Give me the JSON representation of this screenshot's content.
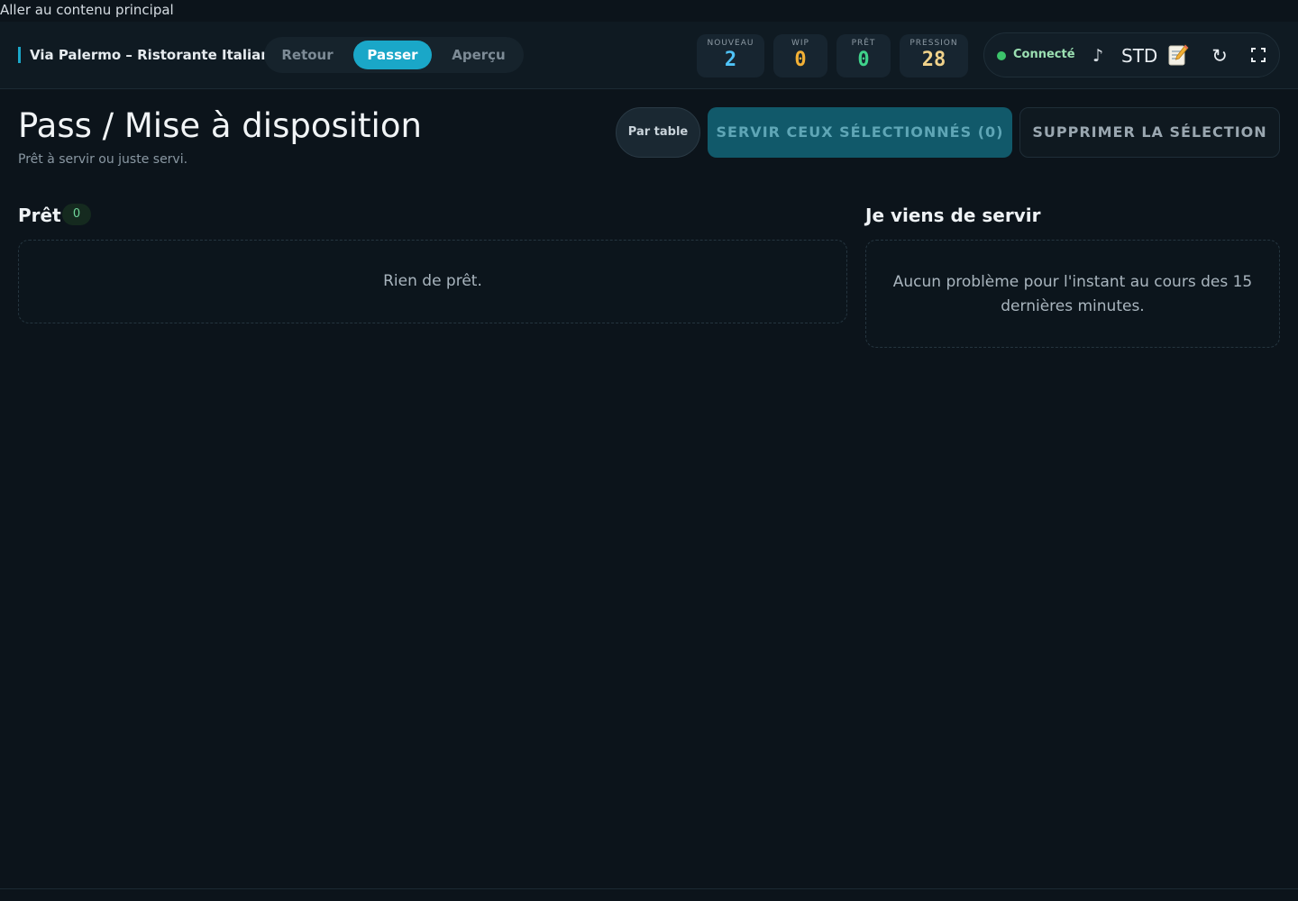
{
  "skip_link": "Aller au contenu principal",
  "header": {
    "brand": "Via Palermo – Ristorante Italiano",
    "modes": [
      {
        "label": "Retour",
        "active": false
      },
      {
        "label": "Passer",
        "active": true
      },
      {
        "label": "Aperçu",
        "active": false
      }
    ],
    "stats": [
      {
        "label": "NOUVEAU",
        "value": "2",
        "color": "#4fc3f7"
      },
      {
        "label": "WIP",
        "value": "0",
        "color": "#f2b035"
      },
      {
        "label": "PRÊT",
        "value": "0",
        "color": "#3fd28a"
      },
      {
        "label": "PRESSION",
        "value": "28",
        "color": "#f0d28a"
      }
    ],
    "status": {
      "connection_label": "Connecté",
      "connection_color": "#3cc36b",
      "music_icon": "♪",
      "profile_label": "STD",
      "memo_icon": "memo-icon",
      "refresh_icon": "↻",
      "fullscreen_icon": "fullscreen-icon"
    }
  },
  "page": {
    "title": "Pass / Mise à disposition",
    "subtitle": "Prêt à servir ou juste servi.",
    "actions": {
      "by_table": "Par table",
      "serve_selected": "SERVIR CEUX SÉLECTIONNÉS (0)",
      "delete_selection": "SUPPRIMER LA SÉLECTION"
    }
  },
  "sections": {
    "ready": {
      "title": "Prêt",
      "count": "0",
      "empty_text": "Rien de prêt."
    },
    "served": {
      "title": "Je viens de servir",
      "empty_text": "Aucun problème pour l'instant au cours des 15 dernières minutes."
    }
  },
  "colors": {
    "background": "#0c141b",
    "accent": "#1aa7c8"
  }
}
